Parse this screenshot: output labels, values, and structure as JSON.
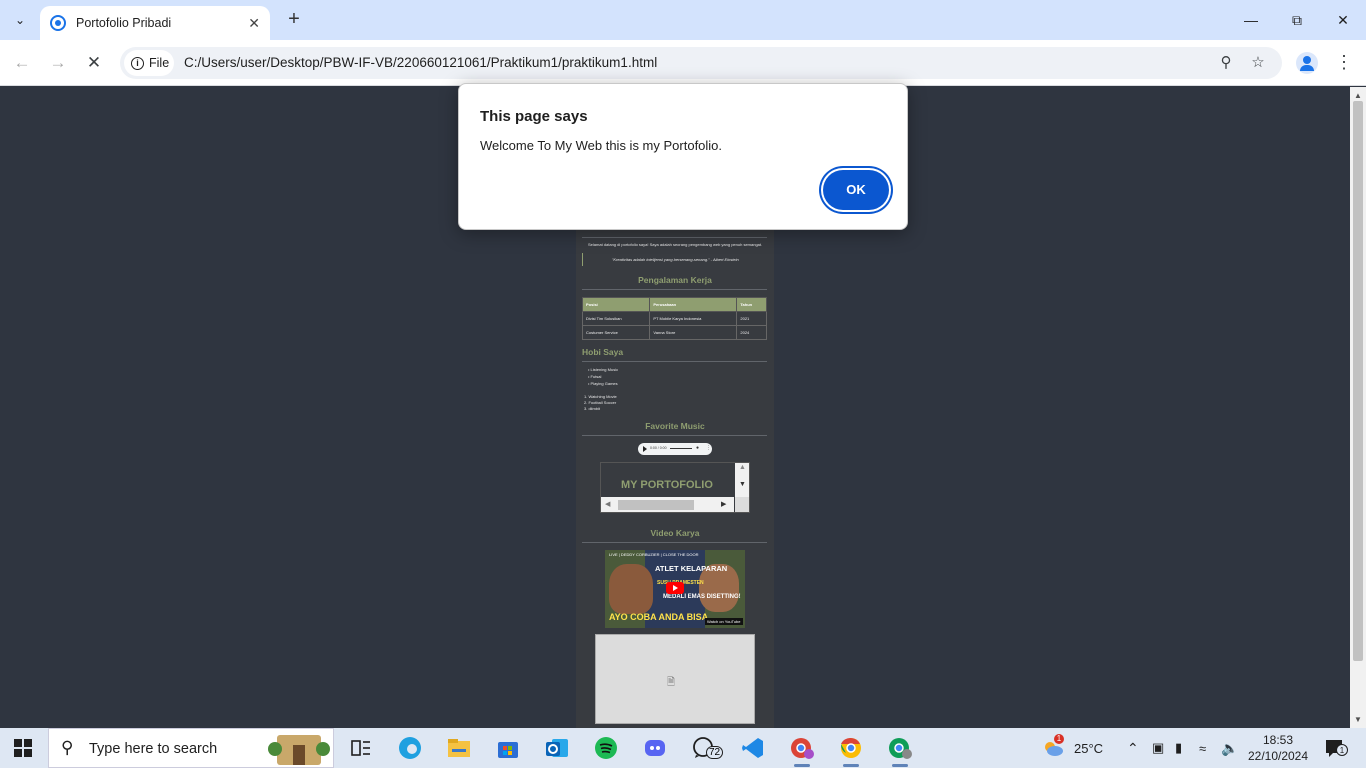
{
  "browser": {
    "tab_title": "Portofolio Pribadi",
    "new_tab_symbol": "+",
    "chip_label": "File",
    "url": "C:/Users/user/Desktop/PBW-IF-VB/220660121061/Praktikum1/praktikum1.html"
  },
  "dialog": {
    "title": "This page says",
    "message": "Welcome To My Web this is my Portofolio.",
    "ok_label": "OK"
  },
  "page": {
    "intro": "Selamat datang di portofolio saya! Saya adalah seorang pengembang web yang penuh semangat.",
    "quote": "\"Kreativitas adalah intelijensi yang bersenang-senang.\" - Albert Einstein",
    "work_heading": "Pengalaman Kerja",
    "work_table": {
      "headers": [
        "Posisi",
        "Perusahaan",
        "Tahun"
      ],
      "rows": [
        [
          "Divisi Tim Solusikan",
          "PT Mobile Karya Indonesia",
          "2021"
        ],
        [
          "Costumer Service",
          "Vanna Store",
          "2024"
        ]
      ]
    },
    "hobby_heading": "Hobi Saya",
    "hobby_ul": [
      "Listening Music",
      "Futsal",
      "Playing Games"
    ],
    "hobby_ol": [
      "1. Watching Movie",
      "2. Football Soccer",
      "3. diimbit"
    ],
    "music_heading": "Favorite Music",
    "audio_time": "0:00 / 0:00",
    "iframe_text": "MY PORTOFOLIO",
    "video_heading": "Video Karya",
    "video": {
      "top_text": "LIVE | DEDDY CORBUZIER | CLOSE THE DOOR",
      "title_line1": "ATLET KELAPARAN",
      "title_line2": "SUSU PRAMESTEN",
      "title_line3": "MEDALI EMAS DISETTING!",
      "bottom_text": "AYO COBA ANDA BISA",
      "watermark": "Watch on YouTube"
    }
  },
  "taskbar": {
    "search_placeholder": "Type here to search",
    "weather": "25°C",
    "time": "18:53",
    "date": "22/10/2024",
    "whatsapp_badge": "72",
    "weather_badge": "1",
    "notif_badge": "1"
  },
  "colors": {
    "accent": "#0b57d0",
    "page_bg": "#2f3540",
    "heading_green": "#8f9e70"
  }
}
